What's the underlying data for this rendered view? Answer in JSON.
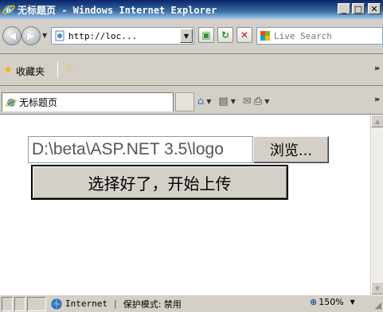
{
  "window": {
    "title": "无标题页 - Windows Internet Explorer",
    "minimize_glyph": "_",
    "maximize_glyph": "□",
    "close_glyph": "✕"
  },
  "toolbar": {
    "back_glyph": "◀",
    "forward_glyph": "▶",
    "address": "http://loc...",
    "search_placeholder": "Live Search"
  },
  "favorites_bar": {
    "label": "收藏夹"
  },
  "tab": {
    "title": "无标题页"
  },
  "page": {
    "file_path": "D:\\beta\\ASP.NET 3.5\\logo",
    "browse_label": "浏览...",
    "upload_label": "选择好了，开始上传"
  },
  "status": {
    "zone": "Internet",
    "separator": "|",
    "protected_mode": "保护模式: 禁用",
    "zoom": "150%"
  },
  "icons": [
    "ie-logo-icon",
    "back-icon",
    "forward-icon",
    "page-icon",
    "compatibility-view-icon",
    "refresh-icon",
    "stop-icon",
    "live-search-icon",
    "favorites-star-icon",
    "add-favorites-icon",
    "home-icon",
    "feeds-icon",
    "mail-icon",
    "print-icon",
    "globe-icon",
    "zoom-icon"
  ],
  "colors": {
    "titlebar_start": "#0a246a",
    "titlebar_end": "#a6caf0",
    "chrome": "#d4d0c8"
  }
}
